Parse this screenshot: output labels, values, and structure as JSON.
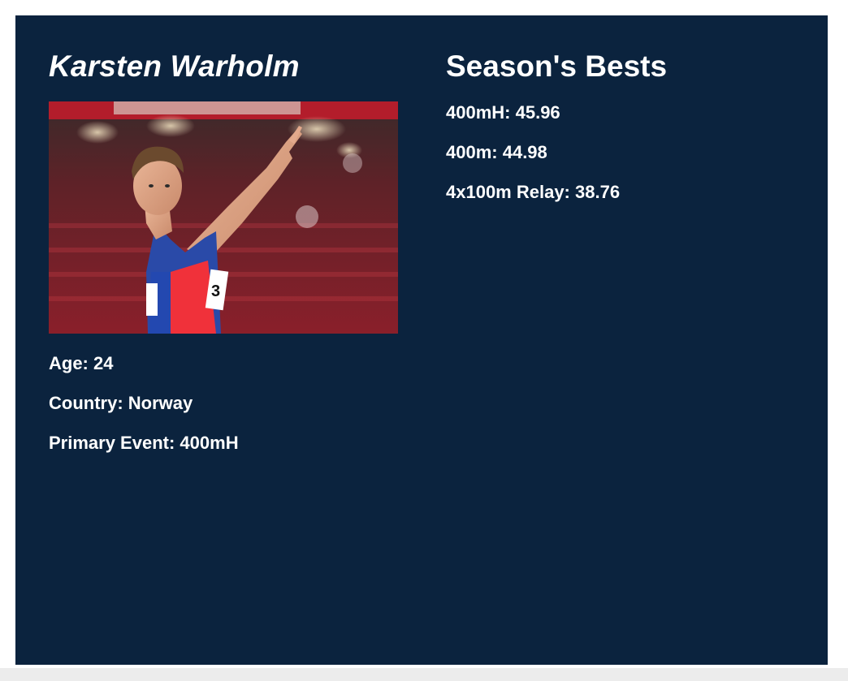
{
  "athlete": {
    "name": "Karsten Warholm",
    "photo_alt": "Karsten Warholm",
    "details": [
      {
        "label": "Age:",
        "value": "24"
      },
      {
        "label": "Country:",
        "value": "Norway"
      },
      {
        "label": "Primary Event:",
        "value": "400mH"
      }
    ]
  },
  "season_bests": {
    "title": "Season's Bests",
    "items": [
      {
        "event": "400mH:",
        "time": "45.96"
      },
      {
        "event": "400m:",
        "time": "44.98"
      },
      {
        "event": "4x100m Relay:",
        "time": "38.76"
      }
    ]
  },
  "colors": {
    "card_background": "#0b233e",
    "text": "#ffffff",
    "page_background": "#ffffff"
  }
}
